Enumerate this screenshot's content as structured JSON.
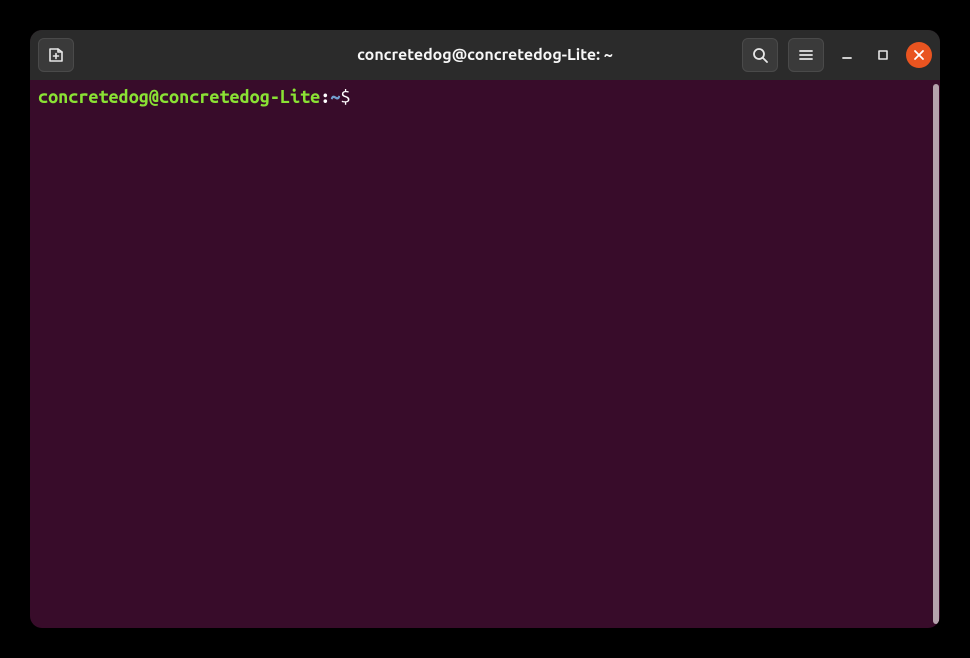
{
  "window": {
    "title": "concretedog@concretedog-Lite: ~"
  },
  "prompt": {
    "userhost": "concretedog@concretedog-Lite",
    "colon": ":",
    "path": "~",
    "sigil": "$",
    "input": ""
  },
  "icons": {
    "new_tab": "new-tab-icon",
    "search": "search-icon",
    "menu": "menu-icon",
    "minimize": "minimize-icon",
    "maximize": "maximize-icon",
    "close": "close-icon"
  },
  "colors": {
    "titlebar": "#2b2b2b",
    "terminal_bg": "#380c2a",
    "prompt_user": "#8ae234",
    "prompt_path": "#729fcf",
    "close_btn": "#e95420"
  }
}
